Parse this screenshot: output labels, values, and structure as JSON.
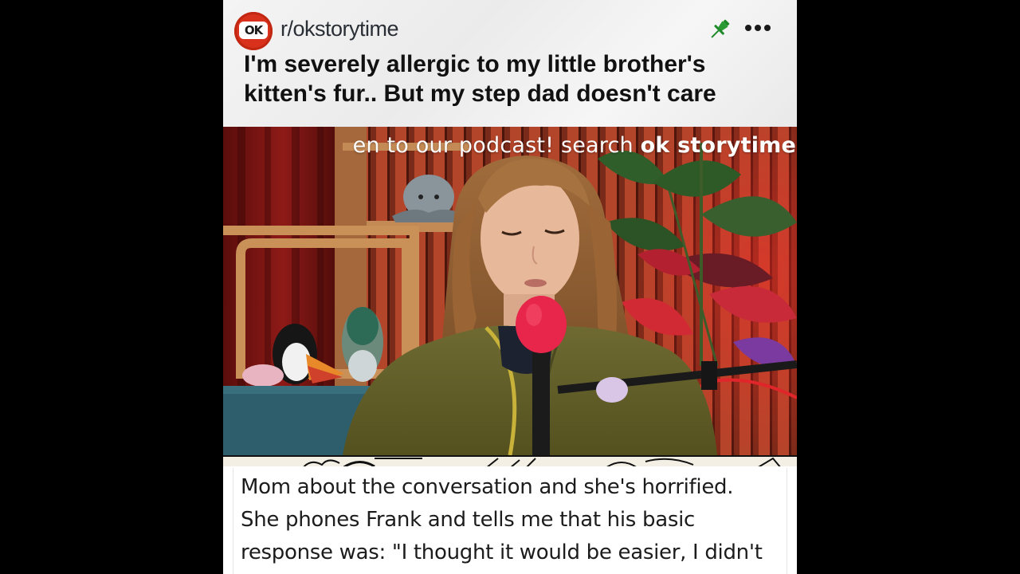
{
  "header": {
    "avatar_logo": "OK",
    "subreddit": "r/okstorytime",
    "title": "I'm severely allergic to my little brother's kitten's fur.. But my step dad doesn't care",
    "icons": {
      "pin": "pin-icon",
      "more": "more-options-icon"
    },
    "accent_color": "#d8321c",
    "pin_color": "#1f8a2a"
  },
  "video": {
    "banner_prefix": "en to our podcast! search ",
    "banner_emphasis": "ok storytime"
  },
  "story": {
    "lines": [
      "Mom about the conversation and she's horrified.",
      "She phones Frank and tells me that his basic",
      "response was: \"I thought it would be easier, I didn't"
    ]
  }
}
